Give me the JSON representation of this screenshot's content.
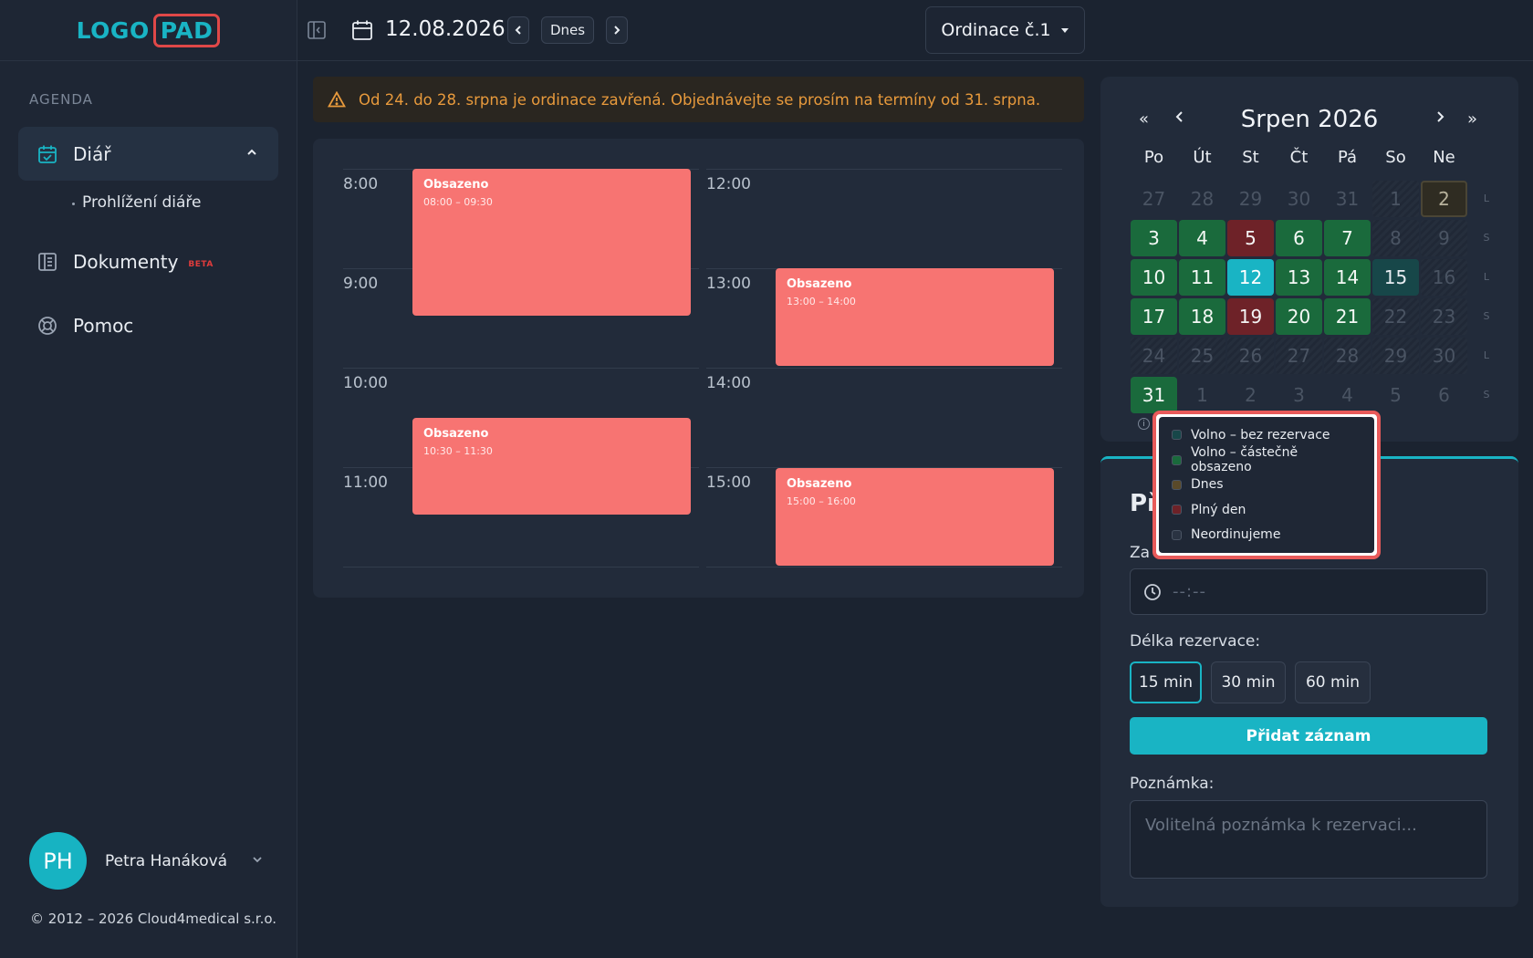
{
  "logo": {
    "left": "LOGO",
    "right": "PAD"
  },
  "sidebar": {
    "section": "AGENDA",
    "items": [
      {
        "label": "Diář",
        "icon": "calendar-check-icon"
      },
      {
        "label": "Prohlížení diáře"
      },
      {
        "label": "Dokumenty",
        "badge": "BETA",
        "icon": "document-icon"
      },
      {
        "label": "Pomoc",
        "icon": "lifebuoy-icon"
      }
    ],
    "user": {
      "initials": "PH",
      "name": "Petra Hanáková"
    },
    "copyright": "© 2012 – 2026 Cloud4medical s.r.o."
  },
  "topbar": {
    "date": "12.08.2026",
    "today_label": "Dnes",
    "office": "Ordinace č.1"
  },
  "alert": {
    "text": "Od 24. do 28. srpna je ordinace zavřená. Objednávejte se prosím na termíny od 31. srpna."
  },
  "schedule": {
    "left_hours": [
      "8:00",
      "9:00",
      "10:00",
      "11:00"
    ],
    "right_hours": [
      "12:00",
      "13:00",
      "14:00",
      "15:00"
    ],
    "events": [
      {
        "title": "Obsazeno",
        "time": "08:00 – 09:30"
      },
      {
        "title": "Obsazeno",
        "time": "10:30 – 11:30"
      },
      {
        "title": "Obsazeno",
        "time": "13:00 – 14:00"
      },
      {
        "title": "Obsazeno",
        "time": "15:00 – 16:00"
      }
    ]
  },
  "calendar": {
    "title": "Srpen 2026",
    "nav": {
      "first": "«",
      "prev": "‹",
      "next": "›",
      "last": "»"
    },
    "weekdays": [
      "Po",
      "Út",
      "St",
      "Čt",
      "Pá",
      "So",
      "Ne"
    ],
    "week_labels": [
      "L",
      "S",
      "L",
      "S",
      "L",
      "S"
    ],
    "rows": [
      [
        {
          "d": "27",
          "s": "muted"
        },
        {
          "d": "28",
          "s": "muted"
        },
        {
          "d": "29",
          "s": "muted"
        },
        {
          "d": "30",
          "s": "muted"
        },
        {
          "d": "31",
          "s": "muted"
        },
        {
          "d": "1",
          "s": "hatch"
        },
        {
          "d": "2",
          "s": "sel"
        }
      ],
      [
        {
          "d": "3",
          "s": "green"
        },
        {
          "d": "4",
          "s": "green"
        },
        {
          "d": "5",
          "s": "red"
        },
        {
          "d": "6",
          "s": "green"
        },
        {
          "d": "7",
          "s": "green"
        },
        {
          "d": "8",
          "s": "hatch"
        },
        {
          "d": "9",
          "s": "hatch"
        }
      ],
      [
        {
          "d": "10",
          "s": "green"
        },
        {
          "d": "11",
          "s": "green"
        },
        {
          "d": "12",
          "s": "today"
        },
        {
          "d": "13",
          "s": "green"
        },
        {
          "d": "14",
          "s": "green"
        },
        {
          "d": "15",
          "s": "free"
        },
        {
          "d": "16",
          "s": "hatch"
        }
      ],
      [
        {
          "d": "17",
          "s": "green"
        },
        {
          "d": "18",
          "s": "green"
        },
        {
          "d": "19",
          "s": "red"
        },
        {
          "d": "20",
          "s": "green"
        },
        {
          "d": "21",
          "s": "green"
        },
        {
          "d": "22",
          "s": "hatch"
        },
        {
          "d": "23",
          "s": "hatch"
        }
      ],
      [
        {
          "d": "24",
          "s": "hatch"
        },
        {
          "d": "25",
          "s": "hatch"
        },
        {
          "d": "26",
          "s": "hatch"
        },
        {
          "d": "27",
          "s": "hatch"
        },
        {
          "d": "28",
          "s": "hatch"
        },
        {
          "d": "29",
          "s": "hatch"
        },
        {
          "d": "30",
          "s": "hatch"
        }
      ],
      [
        {
          "d": "31",
          "s": "green"
        },
        {
          "d": "1",
          "s": "muted"
        },
        {
          "d": "2",
          "s": "muted"
        },
        {
          "d": "3",
          "s": "muted"
        },
        {
          "d": "4",
          "s": "muted"
        },
        {
          "d": "5",
          "s": "muted"
        },
        {
          "d": "6",
          "s": "muted"
        }
      ]
    ]
  },
  "legend": {
    "items": [
      {
        "label": "Volno – bez rezervace",
        "color": "#174749"
      },
      {
        "label": "Volno – částečně obsazeno",
        "color": "#1a6a3c"
      },
      {
        "label": "Dnes",
        "color": "#5a4a2a"
      },
      {
        "label": "Plný den",
        "color": "#6e2228"
      },
      {
        "label": "Neordinujeme",
        "color": "#2a3342"
      }
    ]
  },
  "booking": {
    "title": "Př",
    "time_label": "Za",
    "time_placeholder": "--:--",
    "duration_label": "Délka rezervace:",
    "durations": [
      "15 min",
      "30 min",
      "60 min"
    ],
    "add_label": "Přidat záznam",
    "note_label": "Poznámka:",
    "note_placeholder": "Volitelná poznámka k rezervaci..."
  },
  "colors": {
    "accent": "#19b4c4",
    "event": "#f77472",
    "warning": "#e89a3c"
  }
}
